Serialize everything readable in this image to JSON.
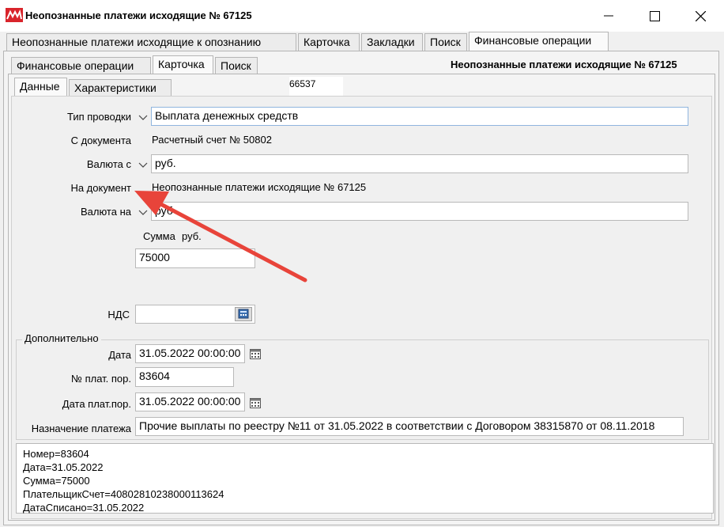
{
  "window": {
    "title": "Неопознанные платежи исходящие № 67125"
  },
  "top_tabs": [
    {
      "label": "Неопознанные платежи исходящие к опознанию"
    },
    {
      "label": "Карточка"
    },
    {
      "label": "Закладки"
    },
    {
      "label": "Поиск"
    },
    {
      "label": "Финансовые операции"
    }
  ],
  "second_tabs": [
    {
      "label": "Финансовые операции"
    },
    {
      "label": "Карточка"
    },
    {
      "label": "Поиск"
    }
  ],
  "card_header": "Неопознанные платежи исходящие № 67125",
  "inner_tabs": [
    {
      "label": "Данные"
    },
    {
      "label": "Характеристики"
    }
  ],
  "record_id": "66537",
  "form": {
    "entry_type_label": "Тип проводки",
    "entry_type_value": "Выплата денежных средств",
    "from_doc_label": "С документа",
    "from_doc_value": "Расчетный счет № 50802",
    "currency_from_label": "Валюта с",
    "currency_from_value": "руб.",
    "to_doc_label": "На документ",
    "to_doc_value": "Неопознанные платежи исходящие № 67125",
    "currency_to_label": "Валюта на",
    "currency_to_value": "руб",
    "amount_label": "Сумма",
    "amount_currency": "руб.",
    "amount_value": "75000",
    "vat_label": "НДС",
    "vat_value": ""
  },
  "extra": {
    "group_label": "Дополнительно",
    "date_label": "Дата",
    "date_value": "31.05.2022 00:00:00",
    "pay_order_label": "№ плат. пор.",
    "pay_order_value": "83604",
    "pay_order_date_label": "Дата плат.пор.",
    "pay_order_date_value": "31.05.2022 00:00:00",
    "purpose_label": "Назначение платежа",
    "purpose_value": "Прочие выплаты по реестру №11 от 31.05.2022 в соответствии с Договором 38315870 от 08.11.2018"
  },
  "memo_lines": [
    "Номер=83604",
    "Дата=31.05.2022",
    "Сумма=75000",
    "ПлательщикСчет=40802810238000113624",
    "ДатаСписано=31.05.2022"
  ],
  "colors": {
    "arrow": "#e8443a",
    "logo": "#d9242b",
    "focus_border": "#8fb5de"
  },
  "icons": {
    "chevron": "chevron-down-icon",
    "calendar": "calendar-icon",
    "calculator": "calculator-icon"
  }
}
